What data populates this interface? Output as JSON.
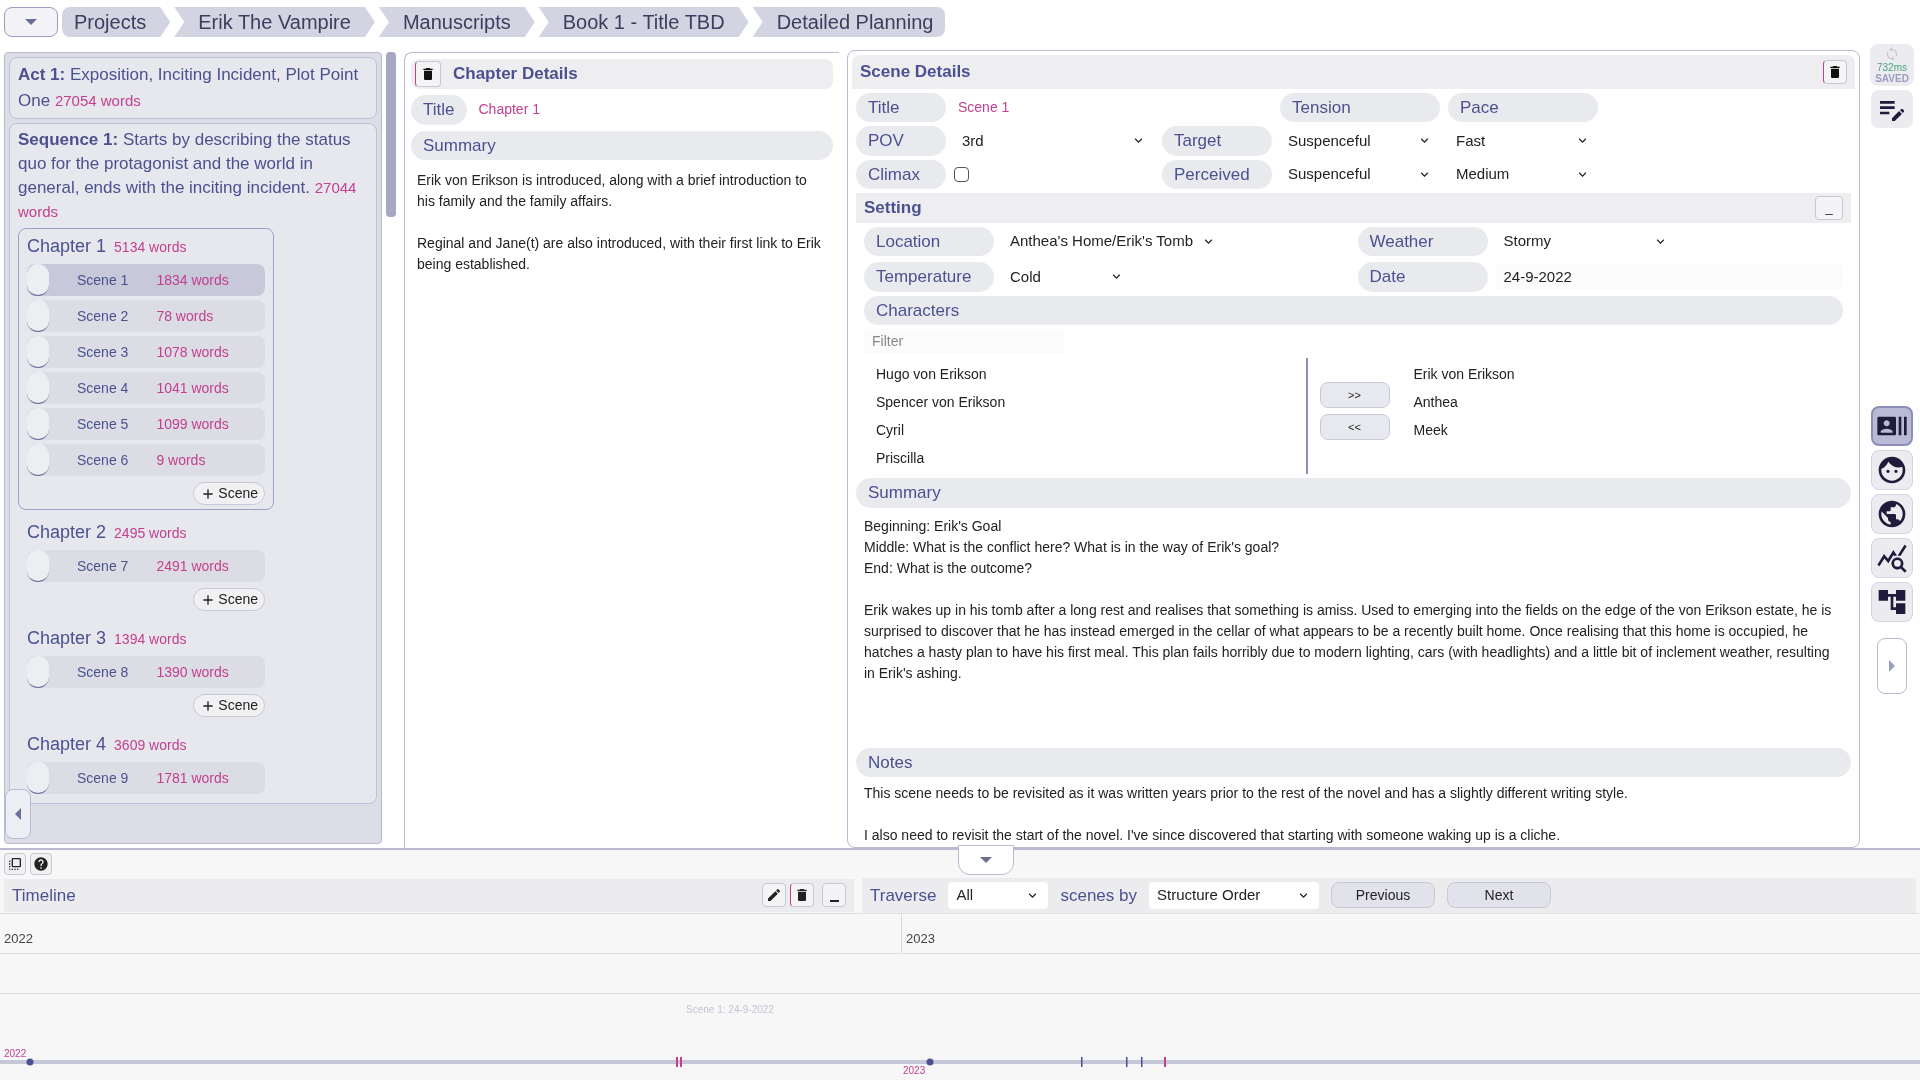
{
  "breadcrumbs": [
    {
      "label": "Projects"
    },
    {
      "label": "Erik The Vampire"
    },
    {
      "label": "Manuscripts"
    },
    {
      "label": "Book 1 - Title TBD"
    },
    {
      "label": "Detailed Planning"
    }
  ],
  "save_status": {
    "time": "732ms",
    "label": "SAVED"
  },
  "outline": {
    "act": {
      "label": "Act 1:",
      "text": "Exposition, Inciting Incident, Plot Point One",
      "words": "27054 words"
    },
    "sequence": {
      "label": "Sequence 1:",
      "text": "Starts by describing the status quo for the protagonist and the world in general, ends with the inciting incident.",
      "words": "27044 words"
    },
    "chapters": [
      {
        "title": "Chapter 1",
        "words": "5134 words",
        "selected": true,
        "add_label": "Scene",
        "scenes": [
          {
            "title": "Scene 1",
            "words": "1834 words",
            "selected": true
          },
          {
            "title": "Scene 2",
            "words": "78 words",
            "selected": false
          },
          {
            "title": "Scene 3",
            "words": "1078 words",
            "selected": false
          },
          {
            "title": "Scene 4",
            "words": "1041 words",
            "selected": false
          },
          {
            "title": "Scene 5",
            "words": "1099 words",
            "selected": false
          },
          {
            "title": "Scene 6",
            "words": "9 words",
            "selected": false
          }
        ]
      },
      {
        "title": "Chapter 2",
        "words": "2495 words",
        "selected": false,
        "add_label": "Scene",
        "scenes": [
          {
            "title": "Scene 7",
            "words": "2491 words",
            "selected": false
          }
        ]
      },
      {
        "title": "Chapter 3",
        "words": "1394 words",
        "selected": false,
        "add_label": "Scene",
        "scenes": [
          {
            "title": "Scene 8",
            "words": "1390 words",
            "selected": false
          }
        ]
      },
      {
        "title": "Chapter 4",
        "words": "3609 words",
        "selected": false,
        "scenes": [
          {
            "title": "Scene 9",
            "words": "1781 words",
            "selected": false
          }
        ]
      }
    ]
  },
  "chapter_details": {
    "heading": "Chapter Details",
    "title_label": "Title",
    "title": "Chapter 1",
    "summary_label": "Summary",
    "summary": "Erik von Erikson is introduced, along with a brief introduction to his family and the family affairs.\n\nReginal and Jane(t) are also introduced, with their first link to Erik being established."
  },
  "scene_details": {
    "heading": "Scene Details",
    "title_label": "Title",
    "title": "Scene 1",
    "pov_label": "POV",
    "pov": "3rd",
    "climax_label": "Climax",
    "climax": {
      "checked": false
    },
    "tension_label": "Tension",
    "pace_label": "Pace",
    "target_label": "Target",
    "target_tension": "Suspenceful",
    "target_pace": "Fast",
    "perceived_label": "Perceived",
    "perceived_tension": "Suspenceful",
    "perceived_pace": "Medium",
    "setting": {
      "heading": "Setting",
      "collapse_label": "_",
      "location_label": "Location",
      "location": "Anthea's Home/Erik's Tomb",
      "weather_label": "Weather",
      "weather": "Stormy",
      "temperature_label": "Temperature",
      "temperature": "Cold",
      "date_label": "Date",
      "date": "24-9-2022"
    },
    "characters": {
      "heading": "Characters",
      "filter_placeholder": "Filter",
      "available": [
        "Hugo von Erikson",
        "Spencer von Erikson",
        "Cyril",
        "Priscilla"
      ],
      "chosen": [
        "Erik von Erikson",
        "Anthea",
        "Meek"
      ],
      "add_label": ">>",
      "remove_label": "<<"
    },
    "summary_label": "Summary",
    "summary": "Beginning: Erik's Goal\nMiddle: What is the conflict here? What is in the way of Erik's goal?\nEnd: What is the outcome?\n\nErik wakes up in his tomb after a long rest and realises that something is amiss. Used to emerging into the fields on the edge of the von Erikson estate, he is surprised to discover that he has instead emerged in the cellar of what appears to be a recently built home. Once realising that this home is occupied, he hatches a hasty plan to have his first meal. This plan fails horribly due to modern lighting, cars (with headlights) and a little bit of inclement weather, resulting in Erik's ashing.",
    "notes_label": "Notes",
    "notes": "This scene needs to be revisited as it was written years prior to the rest of the novel and has a slightly different writing style.\n\nI also need to revisit the start of the novel. I've since discovered that starting with someone waking up is a cliche."
  },
  "tools": [
    {
      "kind": "cards",
      "selected": true
    },
    {
      "kind": "face",
      "selected": false
    },
    {
      "kind": "globe",
      "selected": false
    },
    {
      "kind": "stats",
      "selected": false
    },
    {
      "kind": "tree",
      "selected": false
    }
  ],
  "timeline": {
    "heading": "Timeline",
    "traverse_label": "Traverse",
    "traverse": "All",
    "scenes_by_label": "scenes by",
    "order": "Structure Order",
    "previous": "Previous",
    "next": "Next",
    "years": [
      "2022",
      "2023"
    ],
    "marker_label": "Scene 1: 24-9-2022",
    "scrubber_years": [
      "2022",
      "2023"
    ]
  }
}
